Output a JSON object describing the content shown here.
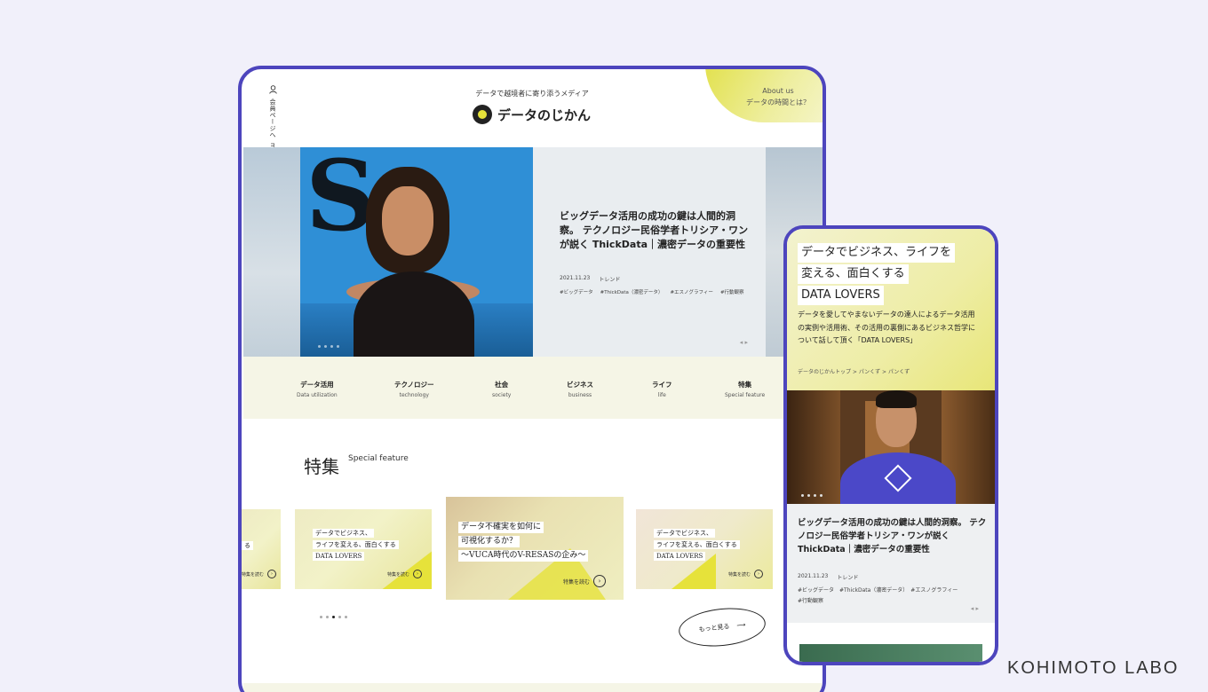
{
  "tablet": {
    "about": {
      "en": "About us",
      "jp": "データの時間とは？"
    },
    "side_rail": {
      "member_page": "会員ページへ",
      "member": "member"
    },
    "tagline": "データで越境者に寄り添うメディア",
    "logo_text": "データのじかん",
    "hero": {
      "title": "ビッグデータ活用の成功の鍵は人間的洞察。 テクノロジー民俗学者トリシア・ワンが説く ThickData｜濃密データの重要性",
      "date": "2021.11.23",
      "category": "トレンド",
      "tags": [
        "#ビッグデータ",
        "#ThickData（濃密データ）",
        "#エスノグラフィー",
        "#行動観察"
      ],
      "arrows": "◂ ▸"
    },
    "categories": [
      {
        "jp": "データ活用",
        "en": "Data utilization"
      },
      {
        "jp": "テクノロジー",
        "en": "technology"
      },
      {
        "jp": "社会",
        "en": "society"
      },
      {
        "jp": "ビジネス",
        "en": "business"
      },
      {
        "jp": "ライフ",
        "en": "life"
      },
      {
        "jp": "特集",
        "en": "Special feature"
      }
    ],
    "feature": {
      "heading_jp": "特集",
      "heading_en": "Special feature",
      "cards": [
        {
          "lines": [
            "る"
          ],
          "more": "特集を読む"
        },
        {
          "lines": [
            "データでビジネス、",
            "ライフを変える、面白くする",
            "DATA LOVERS"
          ],
          "more": "特集を読む"
        },
        {
          "lines": [
            "データ不確実を如何に",
            "可視化するか？",
            "～VUCA時代のV-RESASの企み～"
          ],
          "more": "特集を読む"
        },
        {
          "lines": [
            "データでビジネス、",
            "ライフを変える、面白くする",
            "DATA LOVERS"
          ],
          "more": "特集を読む"
        }
      ],
      "more_button": "もっと見る",
      "more_arrow": "⟶"
    }
  },
  "phone": {
    "headline": [
      "データでビジネス、ライフを",
      "変える、面白くする",
      "DATA LOVERS"
    ],
    "description": "データを愛してやまないデータの達人によるデータ活用の実例や活用術、その活用の裏側にあるビジネス哲学について話して頂く「DATA LOVERS」",
    "breadcrumb": "データのじかんトップ > パンくず > パンくず",
    "card": {
      "title": "ビッグデータ活用の成功の鍵は人間的洞察。 テクノロジー民俗学者トリシア・ワンが説く ThickData｜濃密データの重要性",
      "date": "2021.11.23",
      "category": "トレンド",
      "tags": "#ビッグデータ　#ThickData（濃密データ）　#エスノグラフィー　#行動観察",
      "arrows": "◂ ▸"
    }
  },
  "brand": "KOHIMOTO LABO",
  "colors": {
    "frame": "#4d45bd",
    "accent_yellow": "#e6e23a",
    "background": "#f1f0fa"
  }
}
